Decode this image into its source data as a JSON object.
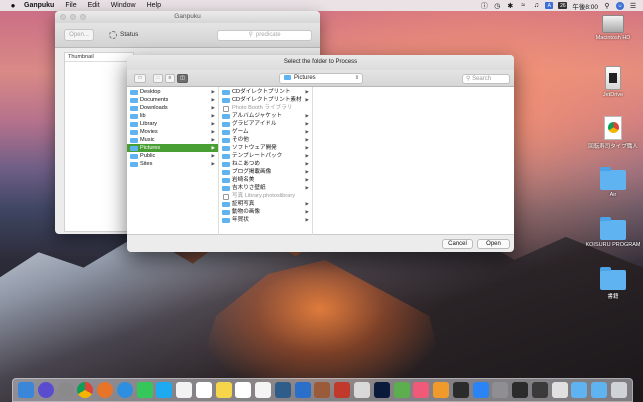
{
  "menubar": {
    "app": "Ganpuku",
    "menus": [
      "File",
      "Edit",
      "Window",
      "Help"
    ],
    "input_badge": "A",
    "date_badge": "26",
    "clock": "午後8:00"
  },
  "desktop_icons": [
    {
      "label": "Macintosh HD",
      "kind": "hd"
    },
    {
      "label": "JetDrive",
      "kind": "flash"
    },
    {
      "label": "回転寿司タイプ職人",
      "kind": "chrome"
    },
    {
      "label": "Air",
      "kind": "folder"
    },
    {
      "label": "KOISURU PROGRAM",
      "kind": "folder"
    },
    {
      "label": "書籍",
      "kind": "folder"
    }
  ],
  "main_window": {
    "title": "Ganpuku",
    "open_button": "Open...",
    "status_label": "Status",
    "predicate_placeholder": "predicate",
    "thumbnail_header": "Thumbnail"
  },
  "dialog": {
    "title": "Select the folder to Process",
    "path": "Pictures",
    "search_placeholder": "Search",
    "cancel": "Cancel",
    "open": "Open",
    "col1": [
      {
        "name": "Desktop",
        "arrow": true
      },
      {
        "name": "Documents",
        "arrow": true
      },
      {
        "name": "Downloads",
        "arrow": true
      },
      {
        "name": "lib",
        "arrow": true
      },
      {
        "name": "Library",
        "arrow": true
      },
      {
        "name": "Movies",
        "arrow": true
      },
      {
        "name": "Music",
        "arrow": true
      },
      {
        "name": "Pictures",
        "arrow": true,
        "selected": true
      },
      {
        "name": "Public",
        "arrow": true
      },
      {
        "name": "Sites",
        "arrow": true
      }
    ],
    "col2": [
      {
        "name": "CDダイレクトプリント",
        "arrow": true
      },
      {
        "name": "CDダイレクトプリント素材",
        "arrow": true
      },
      {
        "name": "Photo Booth ライブラリ",
        "arrow": false,
        "dim": true
      },
      {
        "name": "アルバムジャケット",
        "arrow": true
      },
      {
        "name": "グラビアアイドル",
        "arrow": true
      },
      {
        "name": "ゲーム",
        "arrow": true
      },
      {
        "name": "その他",
        "arrow": true
      },
      {
        "name": "ソフトウェア開発",
        "arrow": true
      },
      {
        "name": "テンプレートパック",
        "arrow": true
      },
      {
        "name": "ねこあつめ",
        "arrow": true
      },
      {
        "name": "ブログ掲載画像",
        "arrow": true
      },
      {
        "name": "岩崎名美",
        "arrow": true
      },
      {
        "name": "吉木りさ壁紙",
        "arrow": true
      },
      {
        "name": "写真 Library.photoslibrary",
        "arrow": false,
        "dim": true
      },
      {
        "name": "証明写真",
        "arrow": true
      },
      {
        "name": "動物の画像",
        "arrow": true
      },
      {
        "name": "年賀状",
        "arrow": true
      }
    ]
  },
  "dock_apps": [
    "finder",
    "siri",
    "launchpad",
    "chrome",
    "firefox",
    "safari",
    "line",
    "skype",
    "mail",
    "calendar",
    "notes",
    "reminders",
    "photos",
    "sourcetree",
    "xcode",
    "dictionary",
    "adobe",
    "mamp",
    "photoshop",
    "coda",
    "itunes",
    "ibooks",
    "kindle",
    "appstore",
    "preferences",
    "terminal",
    "activity",
    "preview",
    "finder2",
    "downloads",
    "trash"
  ]
}
